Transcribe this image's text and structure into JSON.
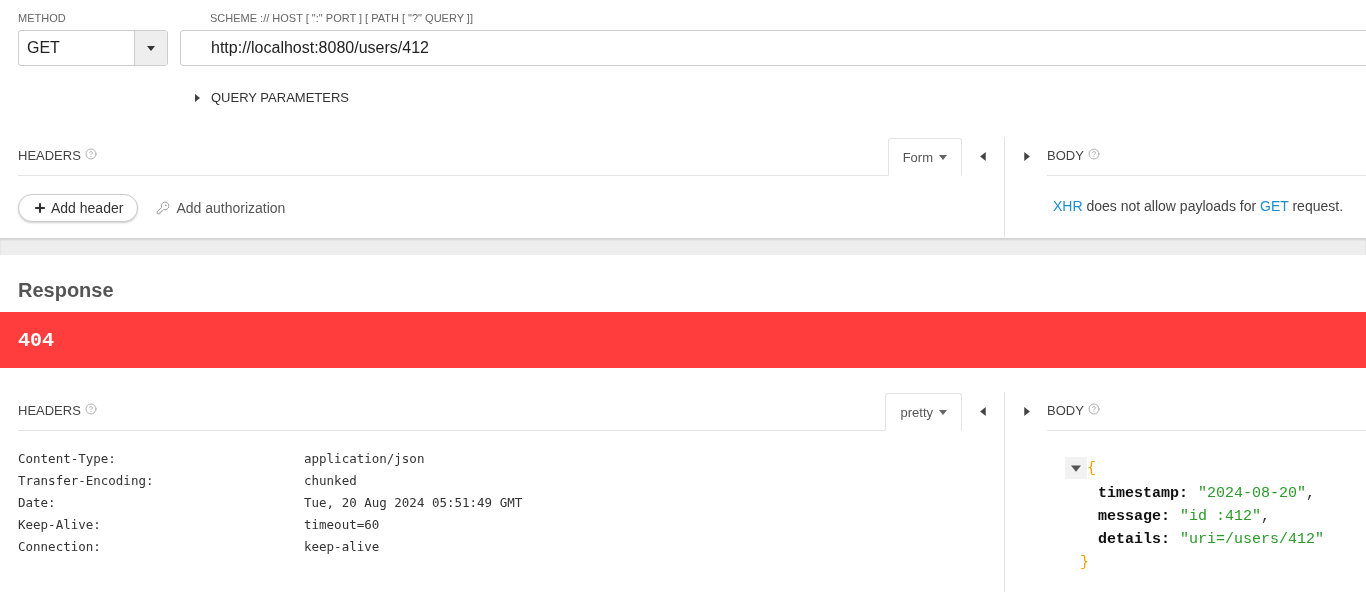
{
  "request": {
    "method": {
      "label": "METHOD",
      "value": "GET"
    },
    "url": {
      "label": "SCHEME :// HOST [ \":\" PORT ] [ PATH [ \"?\" QUERY ]]",
      "value": "http://localhost:8080/users/412"
    },
    "query_parameters": {
      "label": "QUERY PARAMETERS",
      "expanded": false
    },
    "headers": {
      "title": "HEADERS",
      "editor_tab": "Form",
      "add_header": "Add header",
      "add_authorization": "Add authorization"
    },
    "body": {
      "title": "BODY",
      "message": "**XHR** does not allow payloads for **GET** request."
    }
  },
  "response": {
    "title": "Response",
    "status": "404",
    "headers": {
      "title": "HEADERS",
      "view_tab": "pretty",
      "rows": [
        {
          "name": "Content-Type:",
          "value": "application/json"
        },
        {
          "name": "Transfer-Encoding:",
          "value": "chunked"
        },
        {
          "name": "Date:",
          "value": "Tue, 20 Aug 2024 05:51:49 GMT"
        },
        {
          "name": "Keep-Alive:",
          "value": "timeout=60"
        },
        {
          "name": "Connection:",
          "value": "keep-alive"
        }
      ]
    },
    "body": {
      "title": "BODY",
      "expanded": true,
      "open": "{",
      "close": "}",
      "entries": [
        {
          "key": "timestamp:",
          "value": "\"2024-08-20\"",
          "separator": ","
        },
        {
          "key": "message:",
          "value": "\"id :412\"",
          "separator": ","
        },
        {
          "key": "details:",
          "value": "\"uri=/users/412\""
        }
      ]
    }
  }
}
